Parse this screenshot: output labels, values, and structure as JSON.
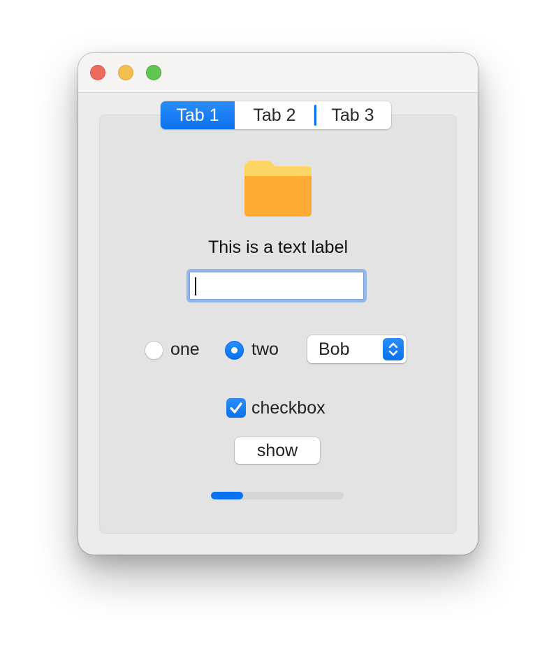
{
  "window": {
    "controls": [
      "close",
      "minimize",
      "zoom"
    ]
  },
  "tabs": [
    {
      "label": "Tab 1",
      "selected": true
    },
    {
      "label": "Tab 2",
      "selected": false
    },
    {
      "label": "Tab 3",
      "selected": false
    }
  ],
  "content": {
    "icon": "folder-icon",
    "text_label": "This is a text label",
    "text_field": {
      "value": "",
      "focused": true
    },
    "radios": [
      {
        "label": "one",
        "selected": false
      },
      {
        "label": "two",
        "selected": true
      }
    ],
    "popup": {
      "selected": "Bob"
    },
    "checkbox": {
      "label": "checkbox",
      "checked": true
    },
    "button_label": "show",
    "progress": {
      "fraction": 0.24
    }
  },
  "colors": {
    "accent": "#0a72f0",
    "folder_body": "#ffaa33",
    "folder_tab": "#fdd566",
    "close": "#ec6a5e",
    "minimize": "#f4bf4f",
    "zoom": "#61c554"
  }
}
